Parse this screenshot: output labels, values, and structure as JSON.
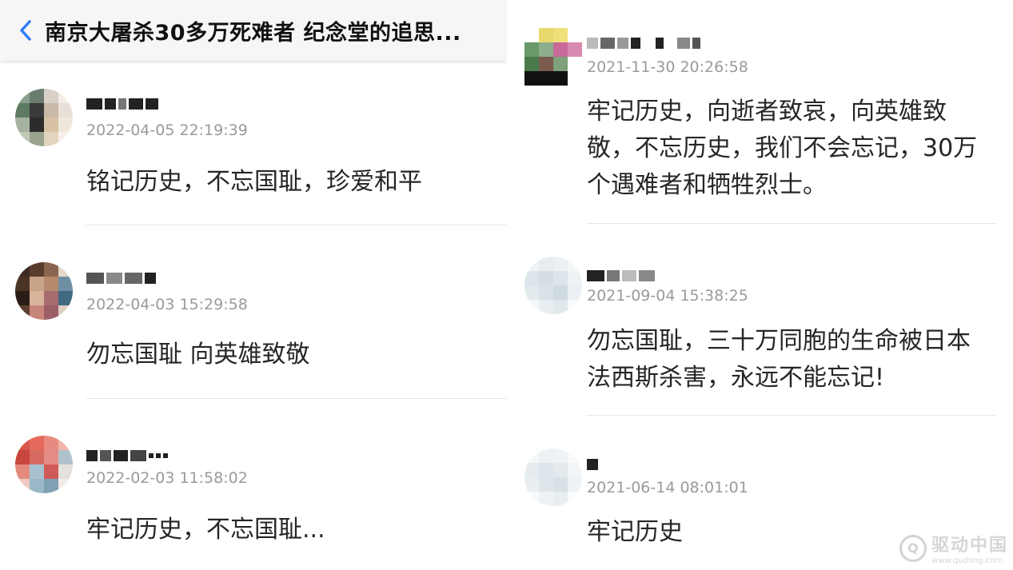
{
  "header": {
    "title": "南京大屠杀30多万死难者 纪念堂的追思..."
  },
  "left_comments": [
    {
      "timestamp": "2022-04-05 22:19:39",
      "text": "铭记历史，不忘国耻，珍爱和平"
    },
    {
      "timestamp": "2022-04-03 15:29:58",
      "text": "勿忘国耻 向英雄致敬"
    },
    {
      "timestamp": "2022-02-03 11:58:02",
      "text": "牢记历史，不忘国耻..."
    }
  ],
  "right_comments": [
    {
      "timestamp": "2021-11-30 20:26:58",
      "lines": [
        "牢记历史，向逝者致哀，向英雄致",
        "敬，不忘历史，我们不会忘记，30万",
        "个遇难者和牺牲烈士。"
      ]
    },
    {
      "timestamp": "2021-09-04 15:38:25",
      "lines": [
        "勿忘国耻，三十万同胞的生命被日本",
        "法西斯杀害，永远不能忘记!"
      ]
    },
    {
      "timestamp": "2021-06-14 08:01:01",
      "lines": [
        "牢记历史"
      ]
    }
  ],
  "watermark": {
    "name": "驱动中国",
    "url": "www.qudong.com"
  },
  "colors": {
    "accent": "#2e7cf6",
    "timestamp": "#9a9a9a",
    "text": "#262626"
  }
}
